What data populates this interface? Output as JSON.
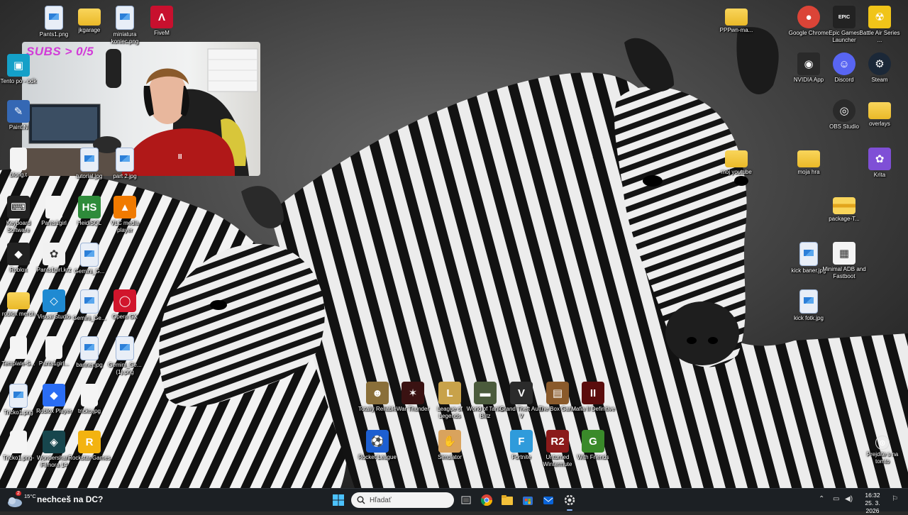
{
  "desktop": {
    "icons_left": [
      {
        "label": "Pants1.png",
        "glyph": "img"
      },
      {
        "label": "jkgarage",
        "glyph": "folder"
      },
      {
        "label": "miniatura koniec.png",
        "glyph": "img"
      },
      {
        "label": "FiveM",
        "glyph": "fivem"
      },
      {
        "label": "Tento po - odk",
        "glyph": "pc"
      },
      {
        "label": "Paint.N",
        "glyph": "paint"
      },
      {
        "label": "blong.t",
        "glyph": "file"
      },
      {
        "label": "tutorial.jpg",
        "glyph": "img"
      },
      {
        "label": "part 2.jpg",
        "glyph": "img"
      },
      {
        "label": "Keyboard Software",
        "glyph": "kbd"
      },
      {
        "label": "Pants1girl",
        "glyph": "file"
      },
      {
        "label": "HeidiSQL",
        "glyph": "heidi"
      },
      {
        "label": "VLC media player",
        "glyph": "vlc"
      },
      {
        "label": "Roblox",
        "glyph": "roblox"
      },
      {
        "label": "Pants1girl.krz",
        "glyph": "krita-file"
      },
      {
        "label": "Gemini_G...",
        "glyph": "img"
      },
      {
        "label": "roblox merch",
        "glyph": "folder"
      },
      {
        "label": "Visual Studio",
        "glyph": "vscode"
      },
      {
        "label": "Gemini_Ge...",
        "glyph": "img"
      },
      {
        "label": "Opera GX",
        "glyph": "operagx"
      },
      {
        "label": "Template-S...",
        "glyph": "file"
      },
      {
        "label": "Pants1girl...",
        "glyph": "file"
      },
      {
        "label": "banner.jpg",
        "glyph": "img"
      },
      {
        "label": "Gemini_Ge... (1).png",
        "glyph": "img"
      },
      {
        "label": "Tricko1.png",
        "glyph": "img"
      },
      {
        "label": "Roblox Player",
        "glyph": "robloxplayer"
      },
      {
        "label": "tricko.jpg",
        "glyph": "file"
      },
      {
        "label": "Tricko1.png-",
        "glyph": "file"
      },
      {
        "label": "Wondershare Filmora 14",
        "glyph": "filmora"
      },
      {
        "label": "Rockstar Games",
        "glyph": "rockstar"
      }
    ],
    "icons_right": [
      {
        "label": "PPPwn-ma...",
        "glyph": "folder"
      },
      {
        "label": "Google Chrome",
        "glyph": "chrome"
      },
      {
        "label": "Epic Games Launcher",
        "glyph": "epic"
      },
      {
        "label": "Battle Air Series ...",
        "glyph": "radiation"
      },
      {
        "label": "NVIDIA App",
        "glyph": "nvidia"
      },
      {
        "label": "Discord",
        "glyph": "discord"
      },
      {
        "label": "Steam",
        "glyph": "steam"
      },
      {
        "label": "OBS Studio",
        "glyph": "obs"
      },
      {
        "label": "overlays",
        "glyph": "folder"
      },
      {
        "label": "moj youtube",
        "glyph": "folder"
      },
      {
        "label": "moja hra",
        "glyph": "folder"
      },
      {
        "label": "Krita",
        "glyph": "krita"
      },
      {
        "label": "package-T...",
        "glyph": "folder-zip"
      },
      {
        "label": "kick baner.jpg",
        "glyph": "img"
      },
      {
        "label": "Minimal ADB and Fastboot",
        "glyph": "adb"
      },
      {
        "label": "kick fotk.jpg",
        "glyph": "img"
      }
    ],
    "icons_games": [
      {
        "label": "Totally Reliable",
        "glyph": "trd"
      },
      {
        "label": "War Thunder",
        "glyph": "warthunder"
      },
      {
        "label": "League of Legends",
        "glyph": "lol"
      },
      {
        "label": "World of Tanks Blitz",
        "glyph": "wot"
      },
      {
        "label": "Grand Theft Auto V",
        "glyph": "gta"
      },
      {
        "label": "The Box Game",
        "glyph": "box"
      },
      {
        "label": "Mafia II Definitive",
        "glyph": "mafia"
      },
      {
        "label": "Rocket League",
        "glyph": "rocket"
      },
      {
        "label": "Simulator",
        "glyph": "goat"
      },
      {
        "label": "Fortnite",
        "glyph": "fortnite"
      },
      {
        "label": "Unturned Wintermute",
        "glyph": "r2"
      },
      {
        "label": "With Friends",
        "glyph": "g"
      }
    ],
    "corner_link": {
      "label": "Prejdite s na tomto"
    }
  },
  "webcam": {
    "overlay_text": "SUBS > 0/5"
  },
  "taskbar": {
    "weather_temp": "15°C",
    "weather_badge": "2",
    "news_text": "nechceš na DC?",
    "search_placeholder": "Hľadať",
    "clock_time": "16:32",
    "clock_date": "25. 3. 2026",
    "pinned": [
      "start",
      "search",
      "task-view",
      "chrome",
      "file-explorer",
      "store",
      "outlook",
      "settings"
    ]
  },
  "colors": {
    "taskbar_bg": "#1c2024",
    "webcam_overlay": "#d23bd8",
    "accent": "#0078d4"
  }
}
